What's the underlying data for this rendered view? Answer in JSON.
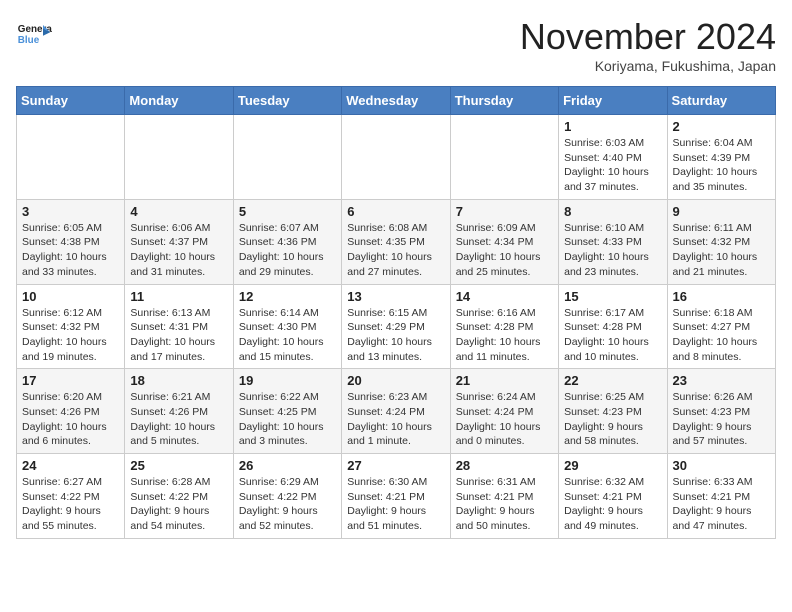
{
  "header": {
    "logo_line1": "General",
    "logo_line2": "Blue",
    "month_title": "November 2024",
    "location": "Koriyama, Fukushima, Japan"
  },
  "weekdays": [
    "Sunday",
    "Monday",
    "Tuesday",
    "Wednesday",
    "Thursday",
    "Friday",
    "Saturday"
  ],
  "weeks": [
    [
      {
        "day": "",
        "info": ""
      },
      {
        "day": "",
        "info": ""
      },
      {
        "day": "",
        "info": ""
      },
      {
        "day": "",
        "info": ""
      },
      {
        "day": "",
        "info": ""
      },
      {
        "day": "1",
        "info": "Sunrise: 6:03 AM\nSunset: 4:40 PM\nDaylight: 10 hours and 37 minutes."
      },
      {
        "day": "2",
        "info": "Sunrise: 6:04 AM\nSunset: 4:39 PM\nDaylight: 10 hours and 35 minutes."
      }
    ],
    [
      {
        "day": "3",
        "info": "Sunrise: 6:05 AM\nSunset: 4:38 PM\nDaylight: 10 hours and 33 minutes."
      },
      {
        "day": "4",
        "info": "Sunrise: 6:06 AM\nSunset: 4:37 PM\nDaylight: 10 hours and 31 minutes."
      },
      {
        "day": "5",
        "info": "Sunrise: 6:07 AM\nSunset: 4:36 PM\nDaylight: 10 hours and 29 minutes."
      },
      {
        "day": "6",
        "info": "Sunrise: 6:08 AM\nSunset: 4:35 PM\nDaylight: 10 hours and 27 minutes."
      },
      {
        "day": "7",
        "info": "Sunrise: 6:09 AM\nSunset: 4:34 PM\nDaylight: 10 hours and 25 minutes."
      },
      {
        "day": "8",
        "info": "Sunrise: 6:10 AM\nSunset: 4:33 PM\nDaylight: 10 hours and 23 minutes."
      },
      {
        "day": "9",
        "info": "Sunrise: 6:11 AM\nSunset: 4:32 PM\nDaylight: 10 hours and 21 minutes."
      }
    ],
    [
      {
        "day": "10",
        "info": "Sunrise: 6:12 AM\nSunset: 4:32 PM\nDaylight: 10 hours and 19 minutes."
      },
      {
        "day": "11",
        "info": "Sunrise: 6:13 AM\nSunset: 4:31 PM\nDaylight: 10 hours and 17 minutes."
      },
      {
        "day": "12",
        "info": "Sunrise: 6:14 AM\nSunset: 4:30 PM\nDaylight: 10 hours and 15 minutes."
      },
      {
        "day": "13",
        "info": "Sunrise: 6:15 AM\nSunset: 4:29 PM\nDaylight: 10 hours and 13 minutes."
      },
      {
        "day": "14",
        "info": "Sunrise: 6:16 AM\nSunset: 4:28 PM\nDaylight: 10 hours and 11 minutes."
      },
      {
        "day": "15",
        "info": "Sunrise: 6:17 AM\nSunset: 4:28 PM\nDaylight: 10 hours and 10 minutes."
      },
      {
        "day": "16",
        "info": "Sunrise: 6:18 AM\nSunset: 4:27 PM\nDaylight: 10 hours and 8 minutes."
      }
    ],
    [
      {
        "day": "17",
        "info": "Sunrise: 6:20 AM\nSunset: 4:26 PM\nDaylight: 10 hours and 6 minutes."
      },
      {
        "day": "18",
        "info": "Sunrise: 6:21 AM\nSunset: 4:26 PM\nDaylight: 10 hours and 5 minutes."
      },
      {
        "day": "19",
        "info": "Sunrise: 6:22 AM\nSunset: 4:25 PM\nDaylight: 10 hours and 3 minutes."
      },
      {
        "day": "20",
        "info": "Sunrise: 6:23 AM\nSunset: 4:24 PM\nDaylight: 10 hours and 1 minute."
      },
      {
        "day": "21",
        "info": "Sunrise: 6:24 AM\nSunset: 4:24 PM\nDaylight: 10 hours and 0 minutes."
      },
      {
        "day": "22",
        "info": "Sunrise: 6:25 AM\nSunset: 4:23 PM\nDaylight: 9 hours and 58 minutes."
      },
      {
        "day": "23",
        "info": "Sunrise: 6:26 AM\nSunset: 4:23 PM\nDaylight: 9 hours and 57 minutes."
      }
    ],
    [
      {
        "day": "24",
        "info": "Sunrise: 6:27 AM\nSunset: 4:22 PM\nDaylight: 9 hours and 55 minutes."
      },
      {
        "day": "25",
        "info": "Sunrise: 6:28 AM\nSunset: 4:22 PM\nDaylight: 9 hours and 54 minutes."
      },
      {
        "day": "26",
        "info": "Sunrise: 6:29 AM\nSunset: 4:22 PM\nDaylight: 9 hours and 52 minutes."
      },
      {
        "day": "27",
        "info": "Sunrise: 6:30 AM\nSunset: 4:21 PM\nDaylight: 9 hours and 51 minutes."
      },
      {
        "day": "28",
        "info": "Sunrise: 6:31 AM\nSunset: 4:21 PM\nDaylight: 9 hours and 50 minutes."
      },
      {
        "day": "29",
        "info": "Sunrise: 6:32 AM\nSunset: 4:21 PM\nDaylight: 9 hours and 49 minutes."
      },
      {
        "day": "30",
        "info": "Sunrise: 6:33 AM\nSunset: 4:21 PM\nDaylight: 9 hours and 47 minutes."
      }
    ]
  ]
}
